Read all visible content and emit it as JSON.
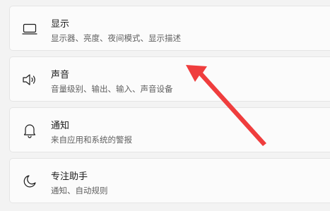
{
  "settings": {
    "items": [
      {
        "icon": "monitor-icon",
        "title": "显示",
        "subtitle": "显示器、亮度、夜间模式、显示描述"
      },
      {
        "icon": "speaker-icon",
        "title": "声音",
        "subtitle": "音量级别、输出、输入、声音设备"
      },
      {
        "icon": "bell-icon",
        "title": "通知",
        "subtitle": "来自应用和系统的警报"
      },
      {
        "icon": "moon-icon",
        "title": "专注助手",
        "subtitle": "通知、自动规则"
      }
    ]
  },
  "annotation": {
    "color": "#ef3d3d"
  }
}
